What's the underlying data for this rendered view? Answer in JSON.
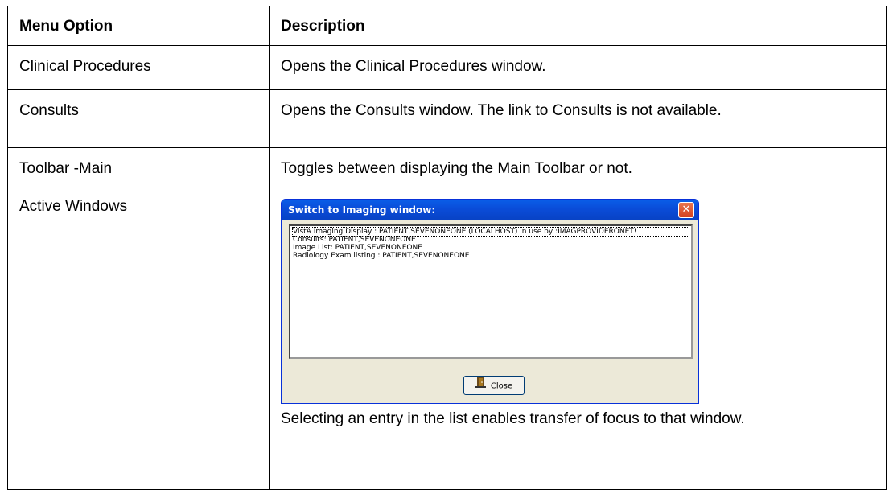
{
  "table": {
    "headers": [
      "Menu Option",
      "Description"
    ],
    "rows": [
      {
        "option": "Clinical Procedures",
        "description": "Opens the Clinical Procedures window."
      },
      {
        "option": "Consults",
        "description": "Opens the Consults window. The link to Consults is not available."
      },
      {
        "option": "Toolbar -Main",
        "description": "Toggles between displaying the Main Toolbar or not."
      },
      {
        "option": "Active Windows",
        "description": "Selecting an entry in the list enables transfer of focus to that window."
      }
    ]
  },
  "dialog": {
    "title": "Switch to Imaging window:",
    "close_icon": "close-icon",
    "items": [
      "VistA Imaging Display : PATIENT,SEVENONEONE (LOCALHOST) in use by :IMAGPROVIDERONET!",
      "Consults: PATIENT,SEVENONEONE",
      "Image List: PATIENT,SEVENONEONE",
      "Radiology Exam listing : PATIENT,SEVENONEONE"
    ],
    "close_button": "Close",
    "close_button_icon": "door-exit-icon",
    "colors": {
      "titlebar": "#0a4cd8",
      "body": "#ece9d8",
      "close": "#d3401e"
    }
  }
}
